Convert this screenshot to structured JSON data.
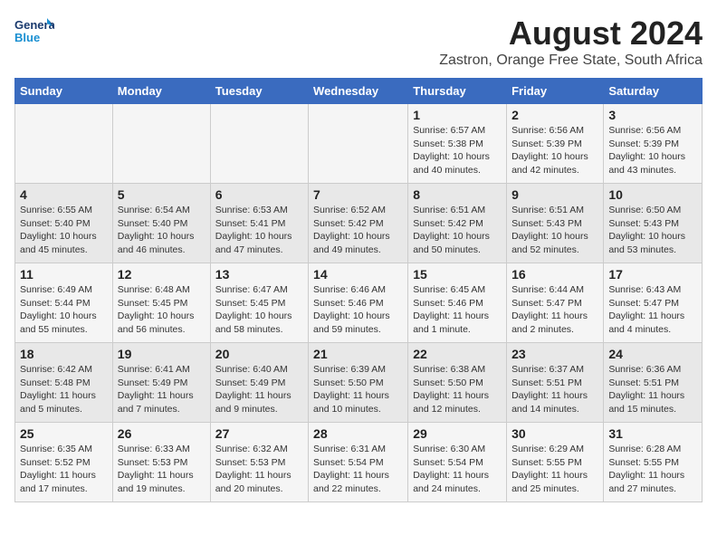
{
  "logo": {
    "line1": "General",
    "line2": "Blue"
  },
  "title": "August 2024",
  "subtitle": "Zastron, Orange Free State, South Africa",
  "weekdays": [
    "Sunday",
    "Monday",
    "Tuesday",
    "Wednesday",
    "Thursday",
    "Friday",
    "Saturday"
  ],
  "weeks": [
    [
      {
        "day": "",
        "info": ""
      },
      {
        "day": "",
        "info": ""
      },
      {
        "day": "",
        "info": ""
      },
      {
        "day": "",
        "info": ""
      },
      {
        "day": "1",
        "info": "Sunrise: 6:57 AM\nSunset: 5:38 PM\nDaylight: 10 hours\nand 40 minutes."
      },
      {
        "day": "2",
        "info": "Sunrise: 6:56 AM\nSunset: 5:39 PM\nDaylight: 10 hours\nand 42 minutes."
      },
      {
        "day": "3",
        "info": "Sunrise: 6:56 AM\nSunset: 5:39 PM\nDaylight: 10 hours\nand 43 minutes."
      }
    ],
    [
      {
        "day": "4",
        "info": "Sunrise: 6:55 AM\nSunset: 5:40 PM\nDaylight: 10 hours\nand 45 minutes."
      },
      {
        "day": "5",
        "info": "Sunrise: 6:54 AM\nSunset: 5:40 PM\nDaylight: 10 hours\nand 46 minutes."
      },
      {
        "day": "6",
        "info": "Sunrise: 6:53 AM\nSunset: 5:41 PM\nDaylight: 10 hours\nand 47 minutes."
      },
      {
        "day": "7",
        "info": "Sunrise: 6:52 AM\nSunset: 5:42 PM\nDaylight: 10 hours\nand 49 minutes."
      },
      {
        "day": "8",
        "info": "Sunrise: 6:51 AM\nSunset: 5:42 PM\nDaylight: 10 hours\nand 50 minutes."
      },
      {
        "day": "9",
        "info": "Sunrise: 6:51 AM\nSunset: 5:43 PM\nDaylight: 10 hours\nand 52 minutes."
      },
      {
        "day": "10",
        "info": "Sunrise: 6:50 AM\nSunset: 5:43 PM\nDaylight: 10 hours\nand 53 minutes."
      }
    ],
    [
      {
        "day": "11",
        "info": "Sunrise: 6:49 AM\nSunset: 5:44 PM\nDaylight: 10 hours\nand 55 minutes."
      },
      {
        "day": "12",
        "info": "Sunrise: 6:48 AM\nSunset: 5:45 PM\nDaylight: 10 hours\nand 56 minutes."
      },
      {
        "day": "13",
        "info": "Sunrise: 6:47 AM\nSunset: 5:45 PM\nDaylight: 10 hours\nand 58 minutes."
      },
      {
        "day": "14",
        "info": "Sunrise: 6:46 AM\nSunset: 5:46 PM\nDaylight: 10 hours\nand 59 minutes."
      },
      {
        "day": "15",
        "info": "Sunrise: 6:45 AM\nSunset: 5:46 PM\nDaylight: 11 hours\nand 1 minute."
      },
      {
        "day": "16",
        "info": "Sunrise: 6:44 AM\nSunset: 5:47 PM\nDaylight: 11 hours\nand 2 minutes."
      },
      {
        "day": "17",
        "info": "Sunrise: 6:43 AM\nSunset: 5:47 PM\nDaylight: 11 hours\nand 4 minutes."
      }
    ],
    [
      {
        "day": "18",
        "info": "Sunrise: 6:42 AM\nSunset: 5:48 PM\nDaylight: 11 hours\nand 5 minutes."
      },
      {
        "day": "19",
        "info": "Sunrise: 6:41 AM\nSunset: 5:49 PM\nDaylight: 11 hours\nand 7 minutes."
      },
      {
        "day": "20",
        "info": "Sunrise: 6:40 AM\nSunset: 5:49 PM\nDaylight: 11 hours\nand 9 minutes."
      },
      {
        "day": "21",
        "info": "Sunrise: 6:39 AM\nSunset: 5:50 PM\nDaylight: 11 hours\nand 10 minutes."
      },
      {
        "day": "22",
        "info": "Sunrise: 6:38 AM\nSunset: 5:50 PM\nDaylight: 11 hours\nand 12 minutes."
      },
      {
        "day": "23",
        "info": "Sunrise: 6:37 AM\nSunset: 5:51 PM\nDaylight: 11 hours\nand 14 minutes."
      },
      {
        "day": "24",
        "info": "Sunrise: 6:36 AM\nSunset: 5:51 PM\nDaylight: 11 hours\nand 15 minutes."
      }
    ],
    [
      {
        "day": "25",
        "info": "Sunrise: 6:35 AM\nSunset: 5:52 PM\nDaylight: 11 hours\nand 17 minutes."
      },
      {
        "day": "26",
        "info": "Sunrise: 6:33 AM\nSunset: 5:53 PM\nDaylight: 11 hours\nand 19 minutes."
      },
      {
        "day": "27",
        "info": "Sunrise: 6:32 AM\nSunset: 5:53 PM\nDaylight: 11 hours\nand 20 minutes."
      },
      {
        "day": "28",
        "info": "Sunrise: 6:31 AM\nSunset: 5:54 PM\nDaylight: 11 hours\nand 22 minutes."
      },
      {
        "day": "29",
        "info": "Sunrise: 6:30 AM\nSunset: 5:54 PM\nDaylight: 11 hours\nand 24 minutes."
      },
      {
        "day": "30",
        "info": "Sunrise: 6:29 AM\nSunset: 5:55 PM\nDaylight: 11 hours\nand 25 minutes."
      },
      {
        "day": "31",
        "info": "Sunrise: 6:28 AM\nSunset: 5:55 PM\nDaylight: 11 hours\nand 27 minutes."
      }
    ]
  ]
}
